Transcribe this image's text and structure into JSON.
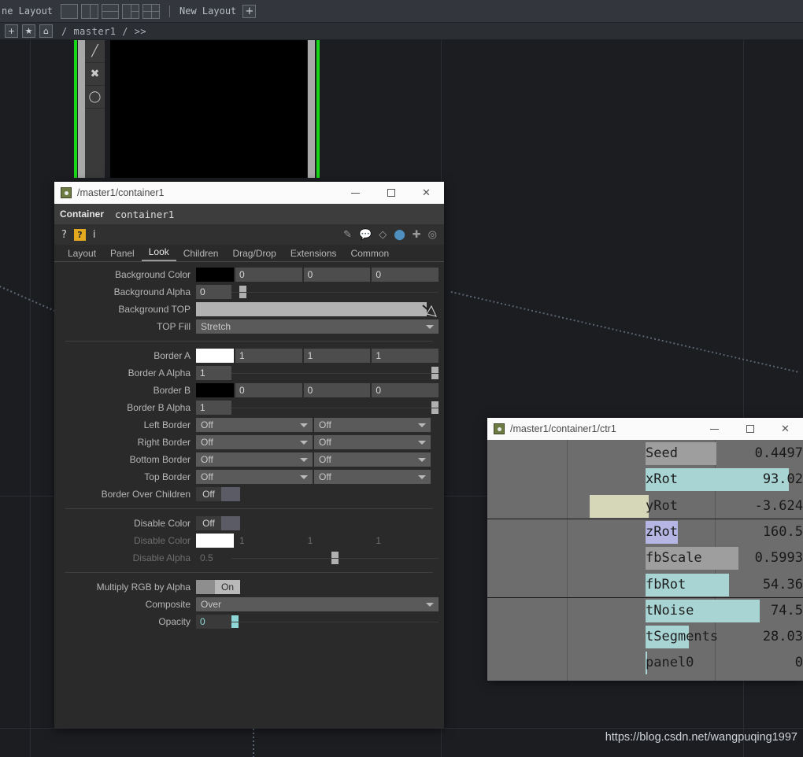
{
  "menubar": {
    "label": "ne Layout",
    "presets": [
      "layout-single",
      "layout-two-col",
      "layout-split-h",
      "layout-three",
      "layout-four"
    ],
    "separator": "|",
    "new_layout_label": "New Layout",
    "plus": "+"
  },
  "pathbar": {
    "add_label": "+",
    "favorite_label": "★",
    "home_label": "⌂",
    "path": "/ master1 /  >>"
  },
  "viewer": {
    "name": "container-viewer"
  },
  "param_dialog": {
    "title": "/master1/container1",
    "window_buttons": {
      "minimize": "—",
      "maximize": "□",
      "close": "✕"
    },
    "operator_type": "Container",
    "operator_name": "container1",
    "icons": {
      "help": "?",
      "help2": "?",
      "info": "i",
      "right": [
        "pencil-icon",
        "comment-icon",
        "bucket-icon",
        "python-icon",
        "plus-icon",
        "target-icon"
      ]
    },
    "tabs": [
      "Layout",
      "Panel",
      "Look",
      "Children",
      "Drag/Drop",
      "Extensions",
      "Common"
    ],
    "active_tab": "Look",
    "rows": [
      {
        "label": "Background Color",
        "type": "color",
        "swatch": "#000000",
        "values": [
          "0",
          "0",
          "0"
        ]
      },
      {
        "label": "Background Alpha",
        "type": "slider",
        "value": "0",
        "pos": 4
      },
      {
        "label": "Background TOP",
        "type": "topfield",
        "value": ""
      },
      {
        "label": "TOP Fill",
        "type": "dropdown_full",
        "value": "Stretch"
      },
      {
        "label": "Border A",
        "type": "color",
        "swatch": "#ffffff",
        "values": [
          "1",
          "1",
          "1"
        ]
      },
      {
        "label": "Border A Alpha",
        "type": "slider",
        "value": "1",
        "pos": 100
      },
      {
        "label": "Border B",
        "type": "color",
        "swatch": "#000000",
        "values": [
          "0",
          "0",
          "0"
        ]
      },
      {
        "label": "Border B Alpha",
        "type": "slider",
        "value": "1",
        "pos": 100
      },
      {
        "label": "Left Border",
        "type": "dropdown2",
        "values": [
          "Off",
          "Off"
        ]
      },
      {
        "label": "Right Border",
        "type": "dropdown2",
        "values": [
          "Off",
          "Off"
        ]
      },
      {
        "label": "Bottom Border",
        "type": "dropdown2",
        "values": [
          "Off",
          "Off"
        ]
      },
      {
        "label": "Top Border",
        "type": "dropdown2",
        "values": [
          "Off",
          "Off"
        ]
      },
      {
        "label": "Border Over Children",
        "type": "toggle",
        "value": "Off",
        "on": false
      },
      {
        "label": "Disable Color",
        "type": "toggle",
        "value": "Off",
        "on": false
      },
      {
        "label": "Disable Color",
        "type": "color_dim",
        "swatch": "#ffffff",
        "values": [
          "1",
          "1",
          "1"
        ]
      },
      {
        "label": "Disable Alpha",
        "type": "slider_dim",
        "value": "0.5",
        "pos": 50
      },
      {
        "label": "Multiply RGB by Alpha",
        "type": "toggle",
        "value": "On",
        "on": true
      },
      {
        "label": "Composite",
        "type": "dropdown_full",
        "value": "Over"
      },
      {
        "label": "Opacity",
        "type": "slider_cyan",
        "value": "0",
        "pos": 0
      }
    ]
  },
  "ctr_window": {
    "title": "/master1/container1/ctr1",
    "window_buttons": {
      "minimize": "—",
      "maximize": "□",
      "close": "✕"
    },
    "sliders": [
      {
        "name": "Seed",
        "value": "0.4497",
        "bar_pct": 46,
        "color": "#9e9e9e",
        "value_bg": null,
        "group_end": false
      },
      {
        "name": "xRot",
        "value": "93.02",
        "bar_pct": 93,
        "color": "#a8d4d4",
        "value_bg": null,
        "group_end": false
      },
      {
        "name": "yRot",
        "value": "-3.624",
        "bar_pct": 2,
        "color": "#d6d6b8",
        "value_bg": "#d6d6b8",
        "group_end": true
      },
      {
        "name": "zRot",
        "value": "160.5",
        "bar_pct": 21,
        "color": "#b6b6e4",
        "value_bg": null,
        "group_end": false
      },
      {
        "name": "fbScale",
        "value": "0.5993",
        "bar_pct": 60,
        "color": "#9e9e9e",
        "value_bg": null,
        "group_end": false
      },
      {
        "name": "fbRot",
        "value": "54.36",
        "bar_pct": 54,
        "color": "#a8d4d4",
        "value_bg": null,
        "group_end": true
      },
      {
        "name": "tNoise",
        "value": "74.5",
        "bar_pct": 74,
        "color": "#a8d4d4",
        "value_bg": null,
        "group_end": false
      },
      {
        "name": "tSegments",
        "value": "28.03",
        "bar_pct": 28,
        "color": "#a8d4d4",
        "value_bg": null,
        "group_end": false
      },
      {
        "name": "panel0",
        "value": "0",
        "bar_pct": 0,
        "color": "#a8d4d4",
        "value_bg": null,
        "group_end": false
      }
    ]
  },
  "watermark": "https://blog.csdn.net/wangpuqing1997"
}
